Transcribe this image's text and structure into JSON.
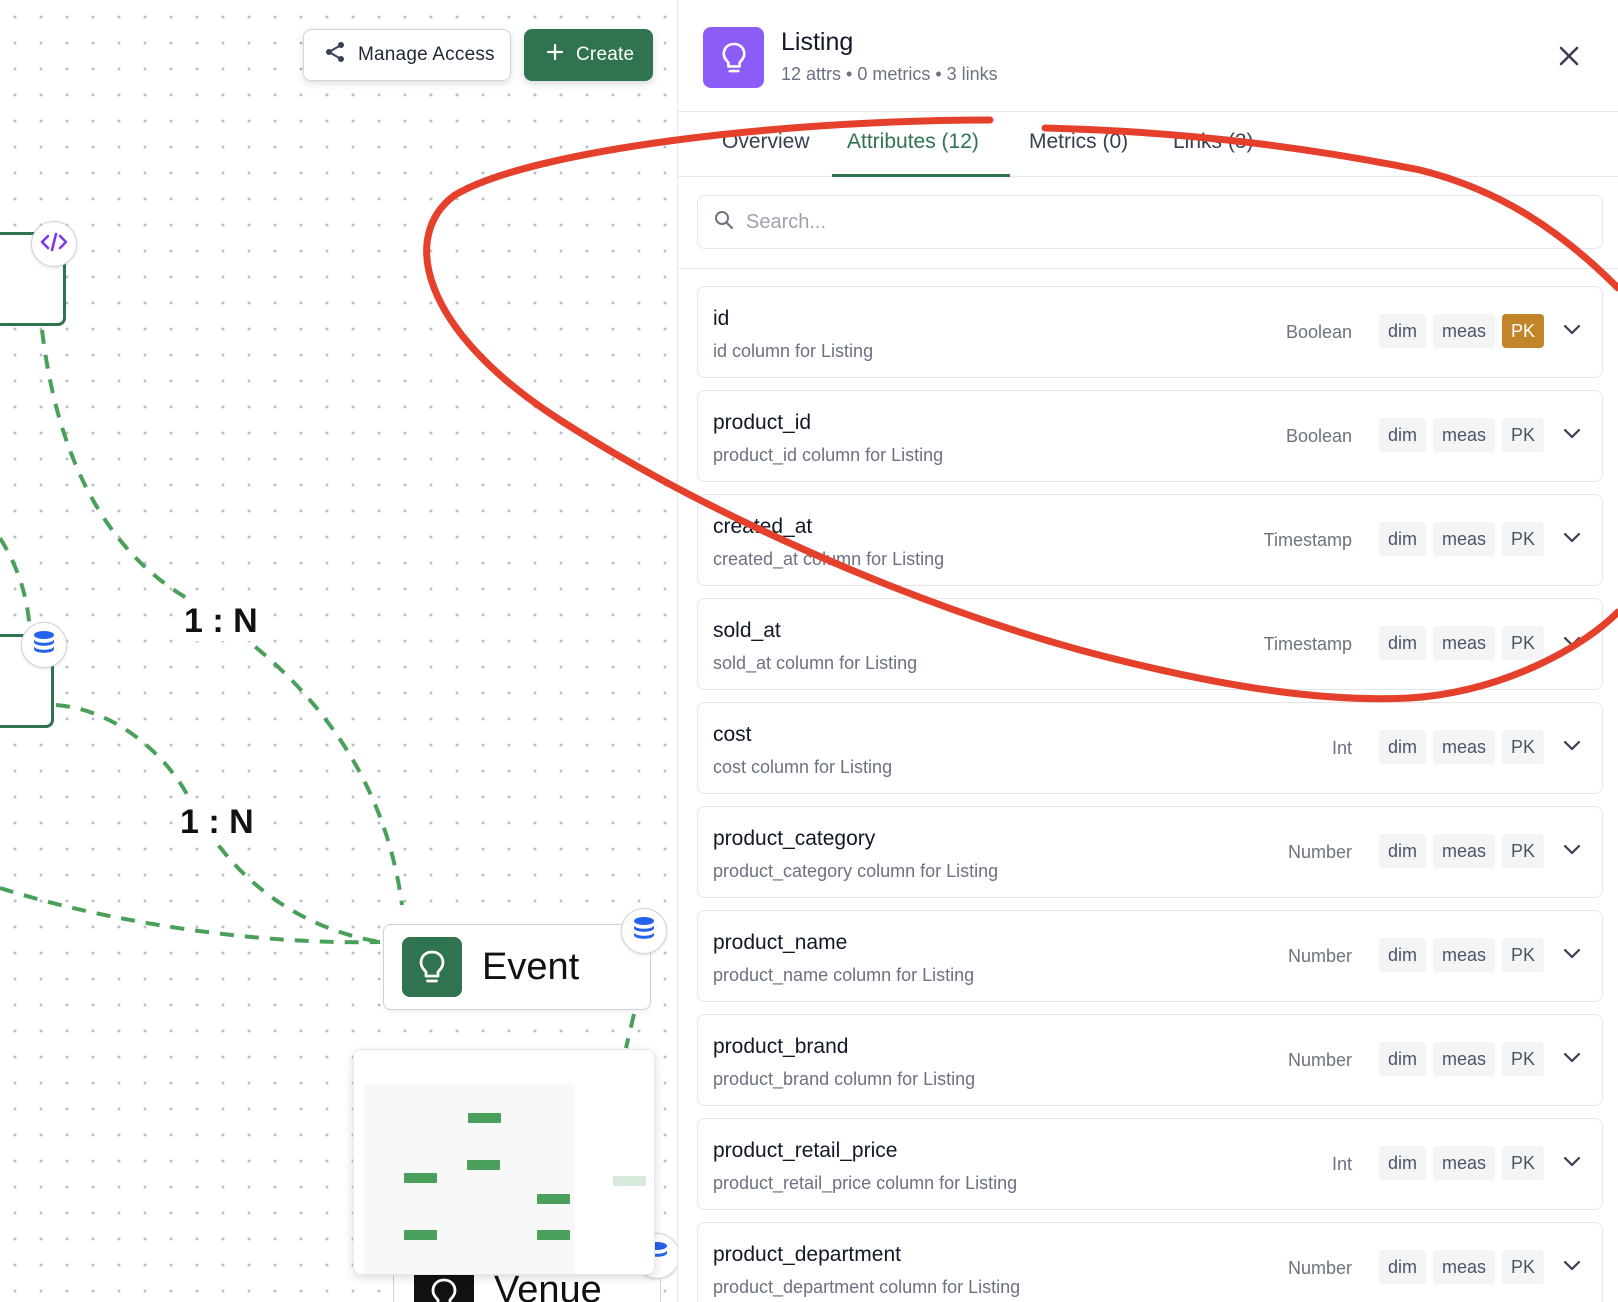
{
  "toolbar": {
    "manage_access_label": "Manage Access",
    "create_label": "Create"
  },
  "canvas": {
    "relations": [
      "1 : N",
      "1 : N"
    ],
    "nodes": [
      {
        "title": "Event",
        "icon": "lightbulb-icon"
      },
      {
        "title": "Venue",
        "icon": "lightbulb-icon"
      }
    ],
    "colors": {
      "edge": "#4aa05a",
      "node_border": "#2f7350",
      "badge_db": "#2563eb",
      "badge_code": "#7c3aed"
    }
  },
  "panel": {
    "title": "Listing",
    "subtitle": "12 attrs • 0 metrics • 3 links",
    "icon": "lightbulb-icon",
    "accent": "#8b5cf6",
    "tabs": [
      {
        "label": "Overview"
      },
      {
        "label": "Attributes (12)",
        "active": true
      },
      {
        "label": "Metrics (0)"
      },
      {
        "label": "Links (3)"
      }
    ],
    "search": {
      "placeholder": "Search...",
      "value": ""
    },
    "attributes": [
      {
        "name": "id",
        "description": "id column for Listing",
        "type": "Boolean",
        "tags": [
          "dim",
          "meas",
          "PK"
        ],
        "pk_active": true
      },
      {
        "name": "product_id",
        "description": "product_id column for Listing",
        "type": "Boolean",
        "tags": [
          "dim",
          "meas",
          "PK"
        ],
        "pk_active": false
      },
      {
        "name": "created_at",
        "description": "created_at column for Listing",
        "type": "Timestamp",
        "tags": [
          "dim",
          "meas",
          "PK"
        ],
        "pk_active": false
      },
      {
        "name": "sold_at",
        "description": "sold_at column for Listing",
        "type": "Timestamp",
        "tags": [
          "dim",
          "meas",
          "PK"
        ],
        "pk_active": false
      },
      {
        "name": "cost",
        "description": "cost column for Listing",
        "type": "Int",
        "tags": [
          "dim",
          "meas",
          "PK"
        ],
        "pk_active": false
      },
      {
        "name": "product_category",
        "description": "product_category column for Listing",
        "type": "Number",
        "tags": [
          "dim",
          "meas",
          "PK"
        ],
        "pk_active": false
      },
      {
        "name": "product_name",
        "description": "product_name column for Listing",
        "type": "Number",
        "tags": [
          "dim",
          "meas",
          "PK"
        ],
        "pk_active": false
      },
      {
        "name": "product_brand",
        "description": "product_brand column for Listing",
        "type": "Number",
        "tags": [
          "dim",
          "meas",
          "PK"
        ],
        "pk_active": false
      },
      {
        "name": "product_retail_price",
        "description": "product_retail_price column for Listing",
        "type": "Int",
        "tags": [
          "dim",
          "meas",
          "PK"
        ],
        "pk_active": false
      },
      {
        "name": "product_department",
        "description": "product_department column for Listing",
        "type": "Number",
        "tags": [
          "dim",
          "meas",
          "PK"
        ],
        "pk_active": false
      }
    ],
    "pk_color": "#c2852a"
  },
  "annotation_color": "#e5402c"
}
